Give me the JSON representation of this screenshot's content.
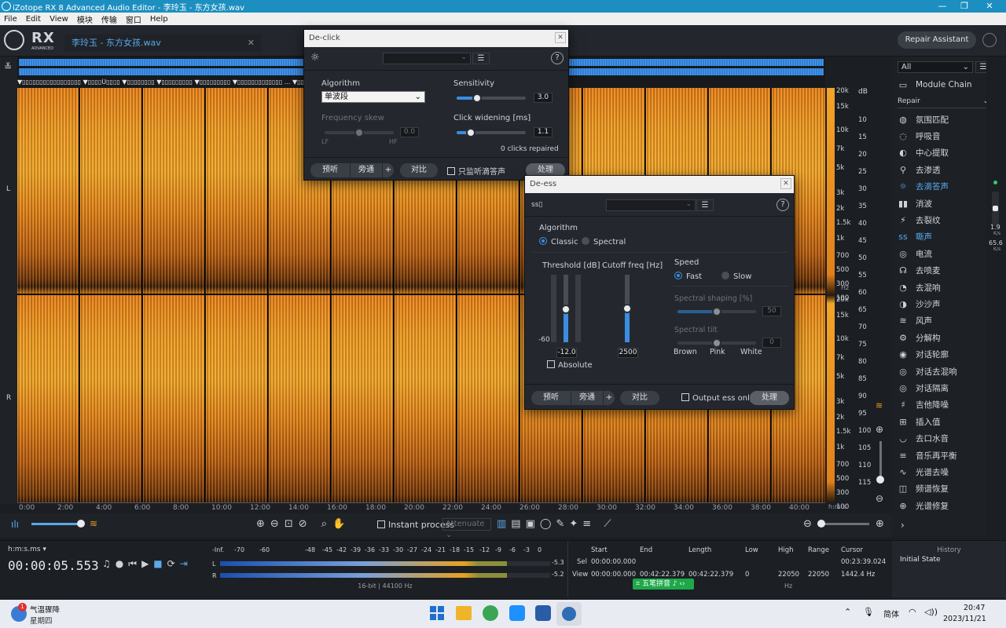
{
  "window": {
    "title": "iZotope RX 8 Advanced Audio Editor - 李玲玉 - 东方女孩.wav"
  },
  "menu": [
    "File",
    "Edit",
    "View",
    "模块",
    "传输",
    "窗口",
    "Help"
  ],
  "brand": {
    "name": "RX",
    "sub": "ADVANCED"
  },
  "file_tab": {
    "label": "李玲玉 - 东方女孩.wav"
  },
  "repair_assistant": "Repair Assistant",
  "markers_text": "▼▯▯▯▯▯▯▯▯▯▯▯▯▯▯▯▯▯  ▼▯▯▯▯Ü▯▯▯▯  ▼▯▯▯▯▯▯▯▯  ▼▯▯▯▯▯▯▯▯▯  ▼▯▯▯▯▯▯▯▯▯  ▼▯▯▯▯▯▯▯▯▯▯▯▯▯ ...  ▼▯▯▯▯▯▯ô▯▯▯  ▼▯▯▯▯▯▯▯h▯▯▯▯▯  ▼▯▯▯▯▯▯▯▯C  ▼▯Ø▯▯▯▯▯G",
  "channels": {
    "left": "L",
    "right": "R"
  },
  "freq_ticks": [
    "20k",
    "15k",
    "10k",
    "7k",
    "5k",
    "3k",
    "2k",
    "1.5k",
    "1k",
    "700",
    "500",
    "300",
    "100"
  ],
  "db_unit": "dB",
  "db_ticks": [
    "10",
    "15",
    "20",
    "25",
    "30",
    "35",
    "40",
    "45",
    "50",
    "55",
    "60"
  ],
  "db_ticks_r": [
    "65",
    "70",
    "75",
    "80",
    "85",
    "90",
    "95",
    "100",
    "105",
    "110",
    "115"
  ],
  "hz_unit": "Hz",
  "time_unit": "h:m:s",
  "time_ticks": [
    "0:00",
    "2:00",
    "4:00",
    "6:00",
    "8:00",
    "10:00",
    "12:00",
    "14:00",
    "16:00",
    "18:00",
    "20:00",
    "22:00",
    "24:00",
    "26:00",
    "28:00",
    "30:00",
    "32:00",
    "34:00",
    "36:00",
    "38:00",
    "40:00"
  ],
  "toolbar": {
    "instant_process": "Instant process",
    "attenuate": "Attenuate"
  },
  "sidebar": {
    "filter": "All",
    "module_chain": "Module Chain",
    "repair": "Repair",
    "items": [
      "氛围匹配",
      "呼吸音",
      "中心提取",
      "去渗透",
      "去滴答声",
      "消波",
      "去裂纹",
      "嘶声",
      "电流",
      "去喷麦",
      "去混响",
      "沙沙声",
      "风声",
      "分解构",
      "对话轮廓",
      "对话去混响",
      "对话隔离",
      "吉他降噪",
      "插入值",
      "去口水音",
      "音乐再平衡",
      "光谱去噪",
      "频谱恢复",
      "光谱修复"
    ]
  },
  "declick": {
    "title": "De-click",
    "algorithm_label": "Algorithm",
    "algorithm_value": "单波段",
    "sensitivity_label": "Sensitivity",
    "sensitivity_value": "3.0",
    "sensitivity": 0.3,
    "freq_skew_label": "Frequency skew",
    "freq_skew_value": "0.0",
    "freq_skew": 0.5,
    "lf": "LF",
    "hf": "HF",
    "click_widening_label": "Click widening [ms]",
    "click_widening_value": "1.1",
    "click_widening": 0.2,
    "status": "0 clicks repaired",
    "preview": "预听",
    "bypass": "旁通",
    "plus": "+",
    "compare": "对比",
    "listen_only": "只监听滴答声",
    "process": "处理"
  },
  "deess": {
    "title": "De-ess",
    "algorithm_label": "Algorithm",
    "classic": "Classic",
    "spectral": "Spectral",
    "threshold_label": "Threshold [dB]",
    "threshold_min": "-60",
    "threshold_value": "-12.0",
    "threshold": 0.8,
    "cutoff_label": "Cutoff freq [Hz]",
    "cutoff_value": "2500",
    "cutoff": 0.5,
    "absolute": "Absolute",
    "speed_label": "Speed",
    "fast": "Fast",
    "slow": "Slow",
    "shaping_label": "Spectral shaping [%]",
    "shaping_value": "50",
    "shaping": 0.5,
    "tilt_label": "Spectral tilt",
    "tilt_value": "0",
    "tilt": 0.5,
    "brown": "Brown",
    "pink": "Pink",
    "white": "White",
    "preview": "预听",
    "bypass": "旁通",
    "plus": "+",
    "compare": "对比",
    "output_ess": "Output ess only",
    "process": "处理"
  },
  "transport": {
    "format_label": "h:m:s.ms",
    "time": "00:00:05.553"
  },
  "meter": {
    "scale": [
      "-Inf.",
      "-70",
      "-60",
      "-48",
      "-45",
      "-42",
      "-39",
      "-36",
      "-33",
      "-30",
      "-27",
      "-24",
      "-21",
      "-18",
      "-15",
      "-12",
      "-9",
      "-6",
      "-3",
      "0"
    ],
    "l_peak": "-5.3",
    "r_peak": "-5.2",
    "l_level": 0.87,
    "r_level": 0.87,
    "format": "16-bit | 44100 Hz"
  },
  "selection": {
    "start_h": "Start",
    "end_h": "End",
    "length_h": "Length",
    "low_h": "Low",
    "high_h": "High",
    "range_h": "Range",
    "cursor_h": "Cursor",
    "sel_label": "Sel",
    "view_label": "View",
    "sel_start": "00:00:00.000",
    "view_start": "00:00:00.000",
    "view_end": "00:42:22.379",
    "view_length": "00:42:22.379",
    "view_low": "0",
    "view_high": "22050",
    "view_range": "22050",
    "hz": "Hz",
    "cursor_time": "00:23:39.024",
    "cursor_freq": "1442.4 Hz"
  },
  "ime": "五笔拼音",
  "history": {
    "title": "History",
    "item": "Initial State"
  },
  "right_strip": {
    "a": "1.9",
    "b": "K/s",
    "c": "65.6",
    "d": "K/s"
  },
  "taskbar": {
    "weather_title": "气温骤降",
    "weather_sub": "星期四",
    "badge": "1",
    "lang": "简体",
    "time": "20:47",
    "date": "2023/11/21"
  }
}
